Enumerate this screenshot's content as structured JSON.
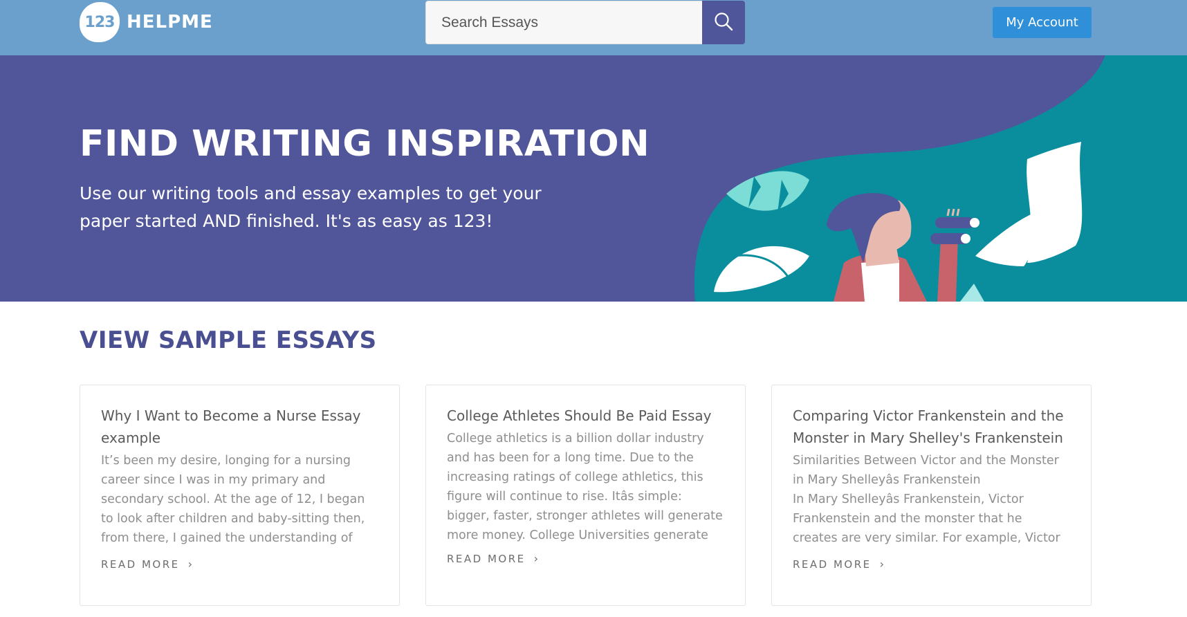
{
  "header": {
    "logo_badge": "123",
    "logo_text": "HELPME",
    "search_placeholder": "Search Essays",
    "search_icon": "search-icon",
    "account_label": "My Account"
  },
  "hero": {
    "title": "FIND WRITING INSPIRATION",
    "subtitle": "Use our writing tools and essay examples to get your paper started AND finished. It's as easy as 123!"
  },
  "section": {
    "title": "VIEW SAMPLE ESSAYS"
  },
  "cards": [
    {
      "title": "Why I Want to Become a Nurse Essay example",
      "excerpt": "It’s been my desire, longing for a nursing career since I was in my primary and secondary school. At the age of 12, I began to look after children and baby-sitting then, from there, I gained the understanding of how to deal with children...",
      "link": "READ MORE"
    },
    {
      "title": "College Athletes Should Be Paid Essay",
      "excerpt": "College athletics is a billion dollar industry and has been for a long time. Due to the increasing ratings of college athletics, this figure will continue to rise. Itâs simple: bigger, faster, stronger athletes will generate more money. College Universities generate so much revenue...",
      "link": "READ MORE"
    },
    {
      "title": "Comparing Victor Frankenstein and the Monster in Mary Shelley's Frankenstein",
      "excerpt": "Similarities Between Victor and the Monster in Mary Shelleyâs Frankenstein\nIn Mary Shelleyâs Frankenstein, Victor Frankenstein and the monster that he creates are very similar. For example, Victor creates...",
      "link": "READ MORE"
    }
  ],
  "colors": {
    "header_bg": "#6b9fcc",
    "hero_bg": "#51569a",
    "teal": "#0a8e9e",
    "accent_button": "#2f8fd8",
    "section_title": "#4a4f92"
  }
}
